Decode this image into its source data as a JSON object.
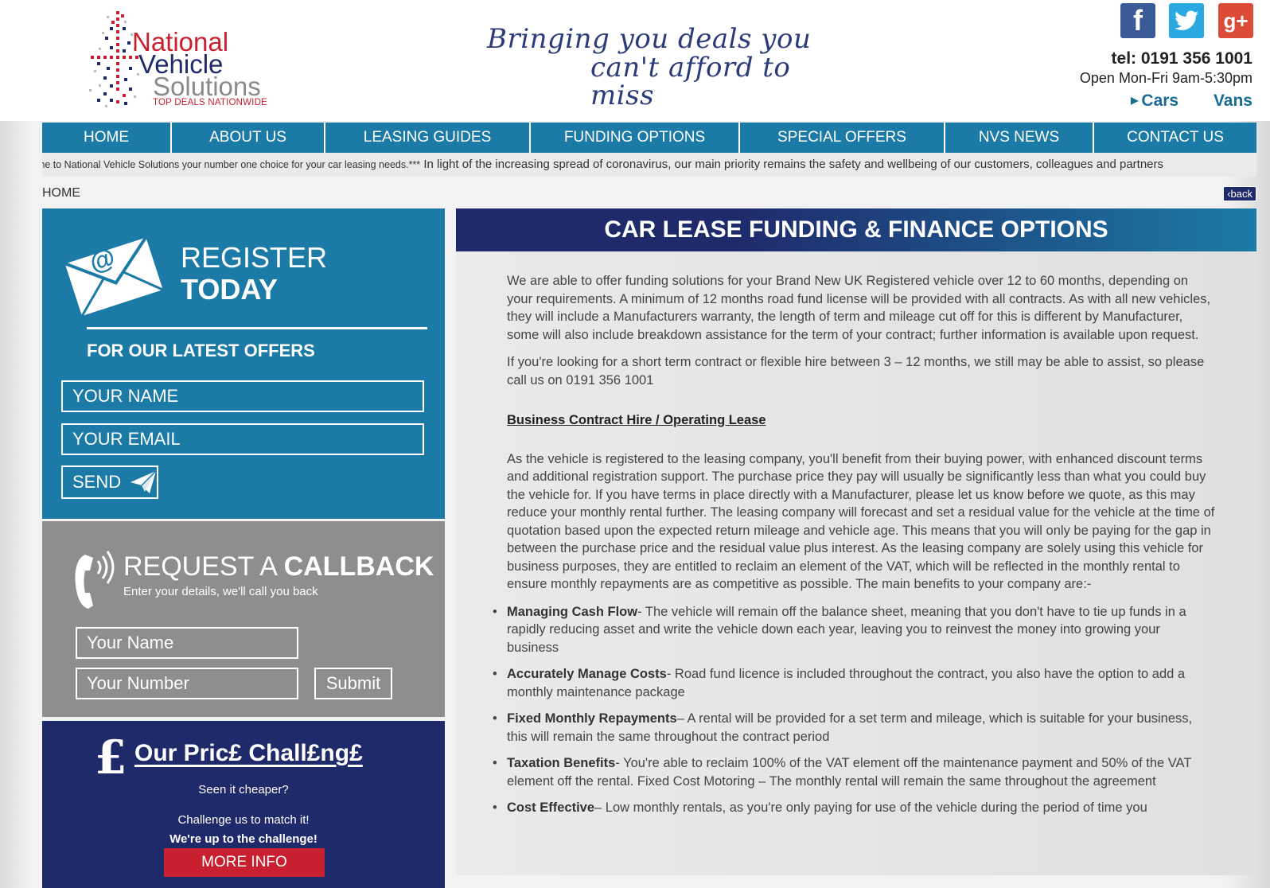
{
  "header": {
    "logo": {
      "line1": "National",
      "line2": "Vehicle",
      "line3": "Solutions",
      "tagline": "TOP DEALS NATIONWIDE"
    },
    "slogan_line1": "Bringing you deals you",
    "slogan_line2": "can't afford to miss",
    "social": {
      "facebook": "f",
      "googleplus": "g+"
    },
    "tel": "tel: 0191 356 1001",
    "hours": "Open Mon-Fri 9am-5:30pm",
    "links": {
      "cars": "Cars",
      "vans": "Vans"
    }
  },
  "nav": [
    {
      "label": "HOME",
      "name": "nav-home"
    },
    {
      "label": "ABOUT US",
      "name": "nav-about-us"
    },
    {
      "label": "LEASING GUIDES",
      "name": "nav-leasing-guides"
    },
    {
      "label": "FUNDING OPTIONS",
      "name": "nav-funding-options"
    },
    {
      "label": "SPECIAL OFFERS",
      "name": "nav-special-offers"
    },
    {
      "label": "NVS NEWS",
      "name": "nav-nvs-news"
    },
    {
      "label": "CONTACT US",
      "name": "nav-contact-us"
    }
  ],
  "ticker": {
    "part1": "ome to National Vehicle Solutions your number one choice for your car leasing needs.***",
    "part2": "In light of the increasing spread of coronavirus, our main priority remains the safety and wellbeing of our customers, colleagues and partners"
  },
  "breadcrumb": {
    "home": "HOME",
    "back": "‹back"
  },
  "register": {
    "title1": "REGISTER",
    "title2": "TODAY",
    "subtitle": "FOR OUR LATEST OFFERS",
    "name_placeholder": "YOUR NAME",
    "email_placeholder": "YOUR EMAIL",
    "send_label": "SEND"
  },
  "callback": {
    "title_light": "REQUEST A ",
    "title_bold": "CALLBACK",
    "subtitle": "Enter your details, we'll call you back",
    "name_placeholder": "Your Name",
    "number_placeholder": "Your Number",
    "submit_label": "Submit"
  },
  "price_challenge": {
    "pound": "£",
    "title": "Our Pric£ Chall£ng£",
    "line1": "Seen it cheaper?",
    "line2": "Challenge us to match it!",
    "line3": "We're up to the challenge!",
    "button": "MORE INFO"
  },
  "main": {
    "title": "CAR LEASE FUNDING & FINANCE OPTIONS",
    "para1": "We are able to offer funding solutions for your Brand New UK Registered vehicle over 12 to 60 months, depending on your requirements.  A minimum of 12 months road fund license will be provided with all contracts.  As with all new vehicles, they will include a Manufacturers warranty, the length of term and mileage cut off for this is different by Manufacturer, some will also include breakdown assistance for the term of your contract; further information is available upon request.",
    "para2": "If you're looking for a short term contract or flexible hire between 3 – 12 months, we still may be able to assist, so please call us on 0191 356 1001",
    "section_heading": "Business Contract Hire / Operating Lease",
    "para3": "As the vehicle is registered to the leasing company, you'll benefit from their buying power, with enhanced discount terms and additional registration support.  The purchase price they pay will usually be significantly less than what you could buy the vehicle for.  If you have terms in place directly with a Manufacturer, please let us know before we quote, as this may reduce your monthly rental further.  The leasing company will forecast and set a residual value for the vehicle at the time of quotation based upon the expected return mileage and vehicle age.  This means that you will only be paying for the gap in between the purchase price and the residual value plus interest.  As the leasing company are solely using this vehicle for business purposes, they are entitled to reclaim an element of the VAT, which will be reflected in the monthly rental to ensure monthly repayments are as competitive as possible.  The main benefits to your company are:-",
    "benefits": [
      {
        "title": "Managing Cash Flow",
        "text": "- The vehicle will remain off the balance sheet, meaning that you don't have to tie up funds in a rapidly reducing asset and write the vehicle down each year, leaving you to reinvest the money into growing your business"
      },
      {
        "title": "Accurately Manage Costs",
        "text": "- Road fund licence is included throughout the contract, you also have the option to add a monthly maintenance package"
      },
      {
        "title": "Fixed Monthly Repayments",
        "text": "– A rental will be provided for a set term and mileage, which is suitable for your business, this will remain the same throughout the contract period"
      },
      {
        "title": "Taxation Benefits",
        "text": "- You're able to reclaim 100% of the VAT element off the maintenance payment and 50% of the VAT element off the rental.  Fixed Cost Motoring – The monthly rental will remain the same throughout the agreement"
      },
      {
        "title": "Cost Effective",
        "text": "– Low monthly rentals, as you're only paying for use of the vehicle during the period of time you"
      }
    ]
  }
}
